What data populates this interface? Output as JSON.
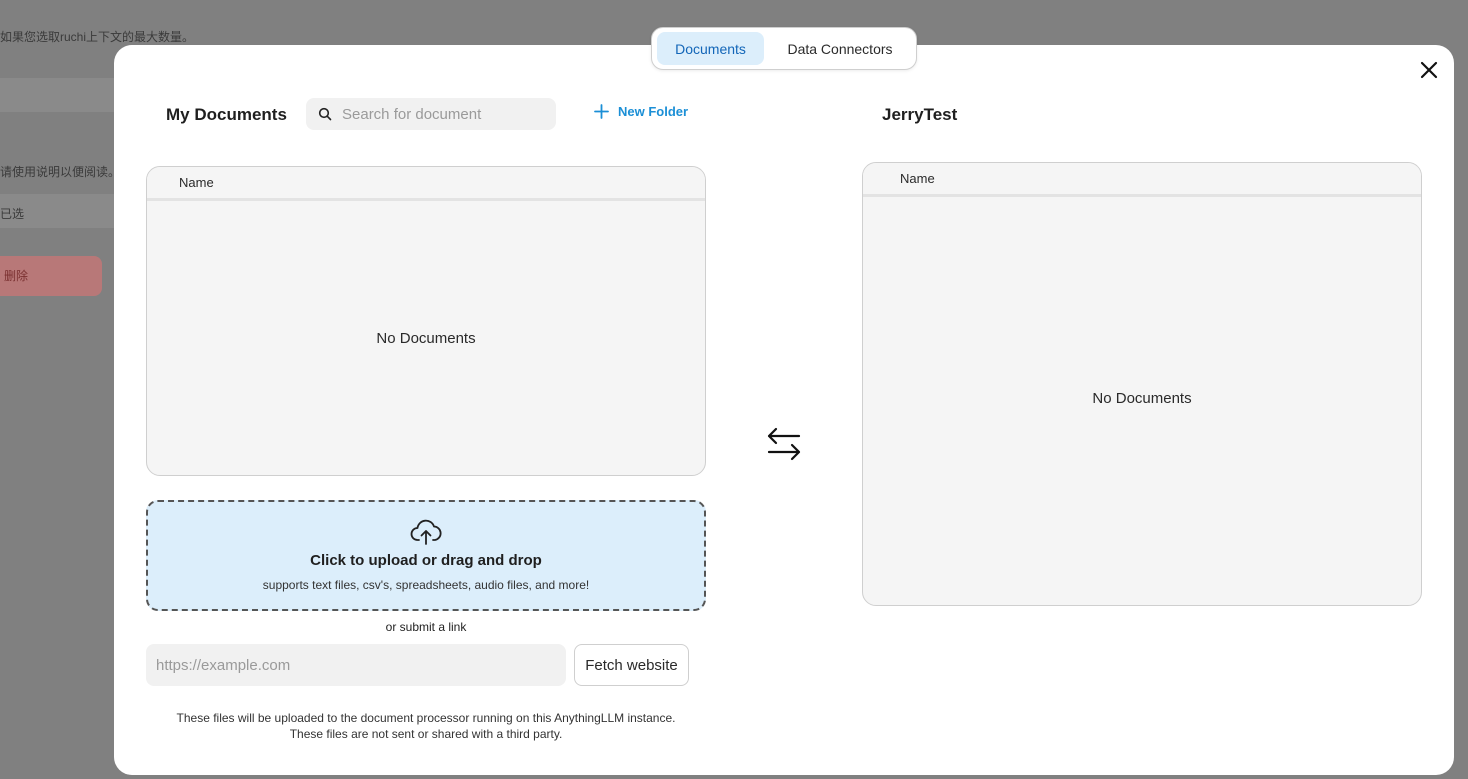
{
  "background": {
    "lines": [
      "如果您选取ruchi上下文的最大数量。",
      "请使用说明以便阅读。",
      "已选",
      "删除"
    ]
  },
  "tabs": [
    {
      "label": "Documents",
      "active": true
    },
    {
      "label": "Data Connectors",
      "active": false
    }
  ],
  "my_documents": {
    "title": "My Documents",
    "search_placeholder": "Search for document",
    "new_folder_label": "New Folder",
    "column_name": "Name",
    "empty_text": "No Documents"
  },
  "workspace": {
    "title": "JerryTest",
    "column_name": "Name",
    "empty_text": "No Documents"
  },
  "upload": {
    "title": "Click to upload or drag and drop",
    "subtitle": "supports text files, csv's, spreadsheets, audio files, and more!",
    "or_link": "or submit a link",
    "link_placeholder": "https://example.com",
    "fetch_label": "Fetch website",
    "disclaimer_line1": "These files will be uploaded to the document processor running on this AnythingLLM instance.",
    "disclaimer_line2": "These files are not sent or shared with a third party."
  },
  "colors": {
    "accent": "#1b8fd6",
    "tab_active_bg": "#dceefb",
    "upload_bg": "#dceefb"
  },
  "icons": {
    "close": "close-icon",
    "search": "search-icon",
    "plus": "plus-icon",
    "swap": "swap-arrows-icon",
    "upload": "cloud-upload-icon"
  }
}
